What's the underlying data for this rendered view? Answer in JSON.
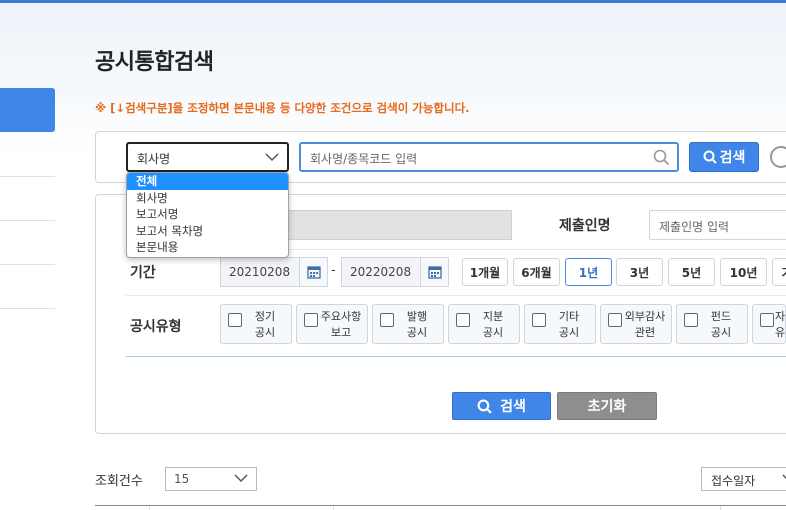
{
  "page": {
    "title": "공시통합검색",
    "notice": "※ [↓검색구분]을 조정하면 본문내용 등 다양한 조건으로 검색이 가능합니다."
  },
  "search": {
    "select_value": "회사명",
    "input_placeholder": "회사명/종목코드 입력",
    "button_label": "검색",
    "dropdown_options": [
      "전체",
      "회사명",
      "보고서명",
      "보고서 목차명",
      "본문내용"
    ],
    "dropdown_selected": "전체"
  },
  "filters": {
    "submitter_label": "제출인명",
    "submitter_placeholder": "제출인명 입력",
    "period_label": "기간",
    "date_from": "20210208",
    "date_sep": "-",
    "date_to": "20220208",
    "period_buttons": [
      "1개월",
      "6개월",
      "1년",
      "3년",
      "5년",
      "10년",
      "기"
    ],
    "period_active": "1년",
    "type_label": "공시유형",
    "types": [
      {
        "line1": "정기",
        "line2": "공시"
      },
      {
        "line1": "주요사항",
        "line2": "보고"
      },
      {
        "line1": "발행",
        "line2": "공시"
      },
      {
        "line1": "지분",
        "line2": "공시"
      },
      {
        "line1": "기타",
        "line2": "공시"
      },
      {
        "line1": "외부감사",
        "line2": "관련"
      },
      {
        "line1": "펀드",
        "line2": "공시"
      },
      {
        "line1": "자",
        "line2": "유"
      }
    ],
    "search_button": "검색",
    "reset_button": "초기화"
  },
  "results": {
    "count_label": "조회건수",
    "count_value": "15",
    "sort_value": "접수일자"
  },
  "colors": {
    "accent": "#3f86e8",
    "notice": "#e8691b",
    "dropdown_highlight": "#1e90ff"
  }
}
